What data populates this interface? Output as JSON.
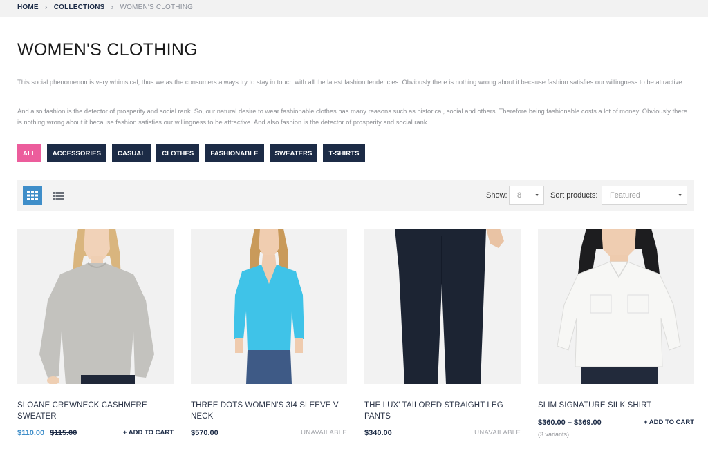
{
  "breadcrumb": {
    "home": "HOME",
    "collections": "COLLECTIONS",
    "current": "WOMEN'S CLOTHING",
    "separator": "›"
  },
  "page": {
    "title": "WOMEN'S CLOTHING",
    "description_1": "This social phenomenon is very whimsical, thus we as the consumers always try to stay in touch with all the latest fashion tendencies. Obviously there is nothing wrong about it because fashion satisfies our willingness to be attractive.",
    "description_2": "And also fashion is the detector of prosperity and social rank. So, our natural desire to wear fashionable clothes has many reasons such as historical, social and others. Therefore being fashionable costs a lot of money. Obviously there is nothing wrong about it because fashion satisfies our willingness to be attractive. And also fashion is the detector of prosperity and social rank."
  },
  "filters": [
    "ALL",
    "ACCESSORIES",
    "CASUAL",
    "CLOTHES",
    "FASHIONABLE",
    "SWEATERS",
    "T-SHIRTS"
  ],
  "active_filter": "ALL",
  "toolbar": {
    "view_grid_icon": "grid-view-icon",
    "view_list_icon": "list-view-icon",
    "show_label": "Show:",
    "show_value": "8",
    "sort_label": "Sort products:",
    "sort_value": "Featured"
  },
  "products": [
    {
      "name": "SLOANE CREWNECK CASHMERE SWEATER",
      "price": "$110.00",
      "compare_price": "$115.00",
      "action": "+ ADD TO CART"
    },
    {
      "name": "THREE DOTS WOMEN'S 3I4 SLEEVE V NECK",
      "price": "$570.00",
      "action": "UNAVAILABLE"
    },
    {
      "name": "THE LUX' TAILORED STRAIGHT LEG PANTS",
      "price": "$340.00",
      "action": "UNAVAILABLE"
    },
    {
      "name": "SLIM SIGNATURE SILK SHIRT",
      "price": "$360.00 – $369.00",
      "variants": "(3 variants)",
      "action": "+ ADD TO CART"
    }
  ],
  "colors": {
    "navy": "#1c2b46",
    "pink_active": "#ec5d9c",
    "blue_accent": "#3f8ec9",
    "sweater_grey": "#c3c2be",
    "top_cyan": "#3fc3e8",
    "pants_navy": "#1c2433",
    "shirt_white": "#f7f7f5"
  }
}
